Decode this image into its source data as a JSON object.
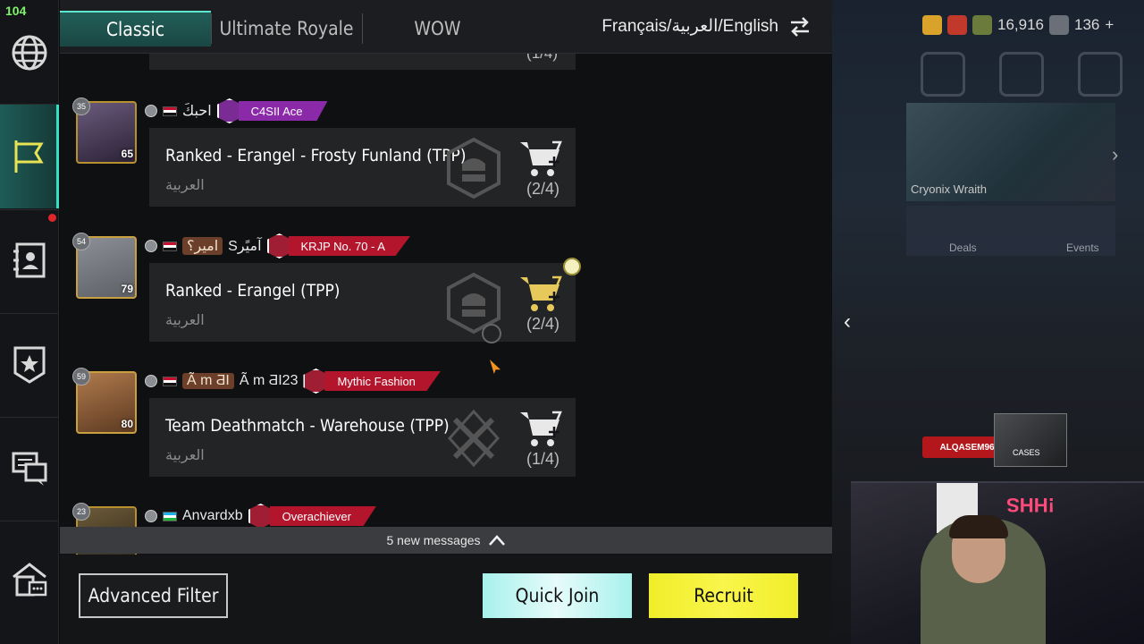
{
  "status": {
    "fps": "104"
  },
  "tabs": [
    {
      "label": "Classic"
    },
    {
      "label": "Ultimate Royale"
    },
    {
      "label": "WOW"
    }
  ],
  "language_filter": "Français/العربية/English",
  "partial_card": {
    "count": "(1/4)"
  },
  "rooms": [
    {
      "player_level": "65",
      "badge": "35",
      "name": "احبكَ",
      "flag": "iq",
      "clan": "C4SII Ace",
      "clan_color": "#8b2aa8",
      "mode": "Ranked - Erangel - Frosty Funland (TPP)",
      "language": "العربية",
      "count": "(2/4)",
      "icon": "classic-mode-icon",
      "gift": false
    },
    {
      "player_level": "79",
      "badge": "54",
      "name_box": "امير؟",
      "name": "Sآمیًر",
      "flag": "iq",
      "clan": "KRJP No. 70 - A",
      "clan_color": "#b3162c",
      "mode": "Ranked - Erangel (TPP)",
      "language": "العربية",
      "count": "(2/4)",
      "icon": "classic-mode-icon",
      "gift": true
    },
    {
      "player_level": "80",
      "badge": "59",
      "name_box": "Ã m ƋI",
      "name": "Ã m ƋI23",
      "flag": "eg",
      "clan": "Mythic Fashion",
      "clan_color": "#b3162c",
      "mode": "Team Deathmatch - Warehouse (TPP)",
      "language": "العربية",
      "count": "(1/4)",
      "icon": "crossed-guns-icon",
      "gift": false
    },
    {
      "badge": "23",
      "name": "Anvardxb",
      "flag": "uz",
      "clan": "Overachiever",
      "clan_color": "#b3162c"
    }
  ],
  "new_messages": "5 new messages",
  "buttons": {
    "advanced_filter": "Advanced Filter",
    "quick_join": "Quick Join",
    "recruit": "Recruit"
  },
  "resources": {
    "gold": "16,916",
    "uc": "136"
  },
  "promo": {
    "title": "Cryonix Wraith",
    "deals": "Deals",
    "events": "Events",
    "code": "ALQASEM96",
    "cases": "CASES"
  },
  "colors": {
    "accent": "#36e0c8",
    "quick_join": "#a8f1ec",
    "recruit": "#f0ee2a"
  }
}
